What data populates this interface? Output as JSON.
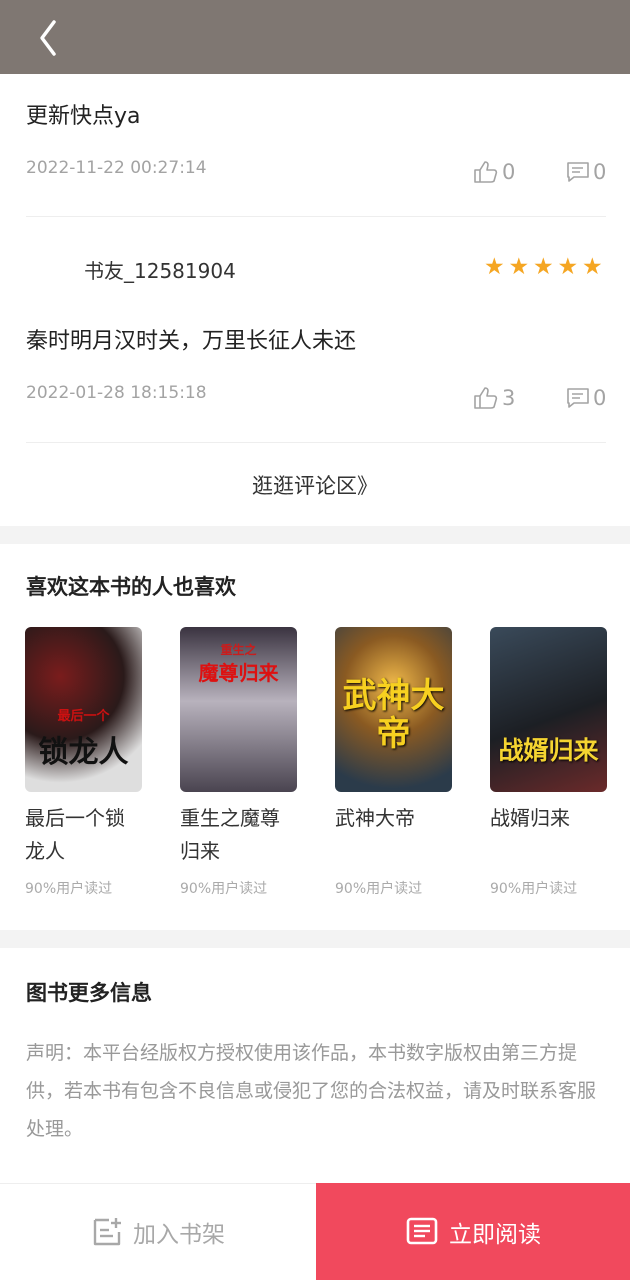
{
  "comments": [
    {
      "text": "更新快点ya",
      "date": "2022-11-22 00:27:14",
      "likes": "0",
      "replies": "0"
    },
    {
      "user": "书友_12581904",
      "stars": 5,
      "text": "秦时明月汉时关，万里长征人未还",
      "date": "2022-01-28 18:15:18",
      "likes": "3",
      "replies": "0"
    }
  ],
  "more_comments": "逛逛评论区》",
  "recommend": {
    "title": "喜欢这本书的人也喜欢",
    "books": [
      {
        "title": "最后一个锁龙人",
        "meta": "90%用户读过",
        "cover_text": "锁龙人",
        "cover_subtitle": "最后一个"
      },
      {
        "title": "重生之魔尊归来",
        "meta": "90%用户读过",
        "cover_text": "魔尊归来",
        "cover_subtitle": "重生之"
      },
      {
        "title": "武神大帝",
        "meta": "90%用户读过",
        "cover_text": "武神大帝",
        "cover_subtitle": ""
      },
      {
        "title": "战婿归来",
        "meta": "90%用户读过",
        "cover_text": "战婿归来",
        "cover_subtitle": ""
      }
    ]
  },
  "info": {
    "title": "图书更多信息",
    "notice": "声明：本平台经版权方授权使用该作品，本书数字版权由第三方提供，若本书有包含不良信息或侵犯了您的合法权益，请及时联系客服处理。"
  },
  "bottom": {
    "add_shelf": "加入书架",
    "read_now": "立即阅读"
  },
  "colors": {
    "accent": "#f1495d",
    "topbar": "#7f7772",
    "star": "#f5a623"
  }
}
